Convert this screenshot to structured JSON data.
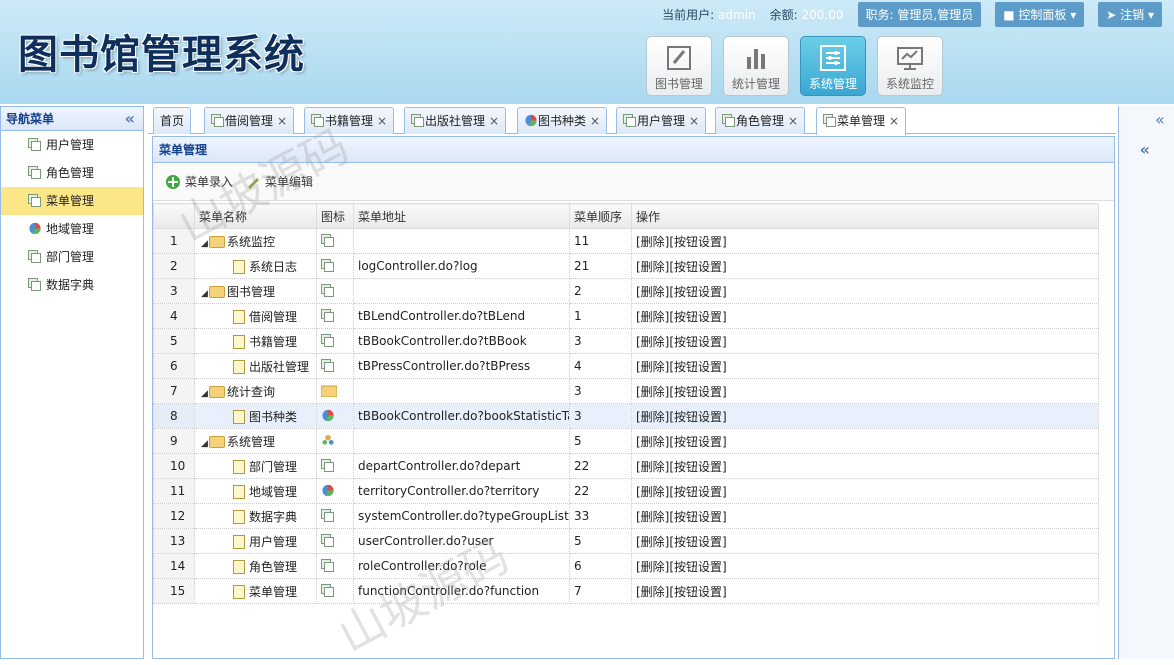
{
  "app": {
    "title": "图书馆管理系统"
  },
  "topbar": {
    "user_label": "当前用户:",
    "user": "admin",
    "balance_label": "余额:",
    "balance": "200.00",
    "role_label": "职务:",
    "role": "管理员,管理员",
    "control_panel": "控制面板",
    "logout": "注销"
  },
  "modules": [
    {
      "label": "图书管理",
      "icon": "edit-icon"
    },
    {
      "label": "统计管理",
      "icon": "bar-chart-icon"
    },
    {
      "label": "系统管理",
      "icon": "settings-sliders-icon"
    },
    {
      "label": "系统监控",
      "icon": "monitor-icon"
    }
  ],
  "nav": {
    "title": "导航菜单",
    "items": [
      {
        "label": "用户管理",
        "icon": "page-icon"
      },
      {
        "label": "角色管理",
        "icon": "page-icon"
      },
      {
        "label": "菜单管理",
        "icon": "page-icon",
        "selected": true
      },
      {
        "label": "地域管理",
        "icon": "pie-icon"
      },
      {
        "label": "部门管理",
        "icon": "page-icon"
      },
      {
        "label": "数据字典",
        "icon": "page-icon"
      }
    ]
  },
  "tabs": [
    {
      "label": "首页",
      "icon": null
    },
    {
      "label": "借阅管理",
      "icon": "page-icon"
    },
    {
      "label": "书籍管理",
      "icon": "page-icon"
    },
    {
      "label": "出版社管理",
      "icon": "page-icon"
    },
    {
      "label": "图书种类",
      "icon": "pie-icon"
    },
    {
      "label": "用户管理",
      "icon": "page-icon"
    },
    {
      "label": "角色管理",
      "icon": "page-icon"
    },
    {
      "label": "菜单管理",
      "icon": "page-icon",
      "active": true
    }
  ],
  "panel": {
    "title": "菜单管理",
    "add_label": "菜单录入",
    "edit_label": "菜单编辑"
  },
  "grid": {
    "headers": [
      "菜单名称",
      "图标",
      "菜单地址",
      "菜单顺序",
      "操作"
    ],
    "rows": [
      {
        "n": "1",
        "name": "系统监控",
        "folder": true,
        "icon": "page-icon",
        "url": "",
        "order": "11",
        "op": "[删除][按钮设置]"
      },
      {
        "n": "2",
        "name": "系统日志",
        "folder": false,
        "icon": "page-icon",
        "url": "logController.do?log",
        "order": "21",
        "op": "[删除][按钮设置]"
      },
      {
        "n": "3",
        "name": "图书管理",
        "folder": true,
        "icon": "page-icon",
        "url": "",
        "order": "2",
        "op": "[删除][按钮设置]"
      },
      {
        "n": "4",
        "name": "借阅管理",
        "folder": false,
        "icon": "page-icon",
        "url": "tBLendController.do?tBLend",
        "order": "1",
        "op": "[删除][按钮设置]"
      },
      {
        "n": "5",
        "name": "书籍管理",
        "folder": false,
        "icon": "page-icon",
        "url": "tBBookController.do?tBBook",
        "order": "3",
        "op": "[删除][按钮设置]"
      },
      {
        "n": "6",
        "name": "出版社管理",
        "folder": false,
        "icon": "page-icon",
        "url": "tBPressController.do?tBPress",
        "order": "4",
        "op": "[删除][按钮设置]"
      },
      {
        "n": "7",
        "name": "统计查询",
        "folder": true,
        "icon": "folder-icon",
        "url": "",
        "order": "3",
        "op": "[删除][按钮设置]"
      },
      {
        "n": "8",
        "name": "图书种类",
        "folder": false,
        "icon": "pie-icon",
        "url": "tBBookController.do?bookStatisticTabs",
        "order": "3",
        "op": "[删除][按钮设置]",
        "hl": true
      },
      {
        "n": "9",
        "name": "系统管理",
        "folder": true,
        "icon": "users-icon",
        "url": "",
        "order": "5",
        "op": "[删除][按钮设置]"
      },
      {
        "n": "10",
        "name": "部门管理",
        "folder": false,
        "icon": "page-icon",
        "url": "departController.do?depart",
        "order": "22",
        "op": "[删除][按钮设置]"
      },
      {
        "n": "11",
        "name": "地域管理",
        "folder": false,
        "icon": "pie-icon",
        "url": "territoryController.do?territory",
        "order": "22",
        "op": "[删除][按钮设置]"
      },
      {
        "n": "12",
        "name": "数据字典",
        "folder": false,
        "icon": "page-icon",
        "url": "systemController.do?typeGroupList",
        "order": "33",
        "op": "[删除][按钮设置]"
      },
      {
        "n": "13",
        "name": "用户管理",
        "folder": false,
        "icon": "page-icon",
        "url": "userController.do?user",
        "order": "5",
        "op": "[删除][按钮设置]"
      },
      {
        "n": "14",
        "name": "角色管理",
        "folder": false,
        "icon": "page-icon",
        "url": "roleController.do?role",
        "order": "6",
        "op": "[删除][按钮设置]"
      },
      {
        "n": "15",
        "name": "菜单管理",
        "folder": false,
        "icon": "page-icon",
        "url": "functionController.do?function",
        "order": "7",
        "op": "[删除][按钮设置]"
      }
    ]
  },
  "watermark": "山坡源码",
  "colors": {
    "header_bg": "#a9d8ef",
    "accent": "#3aa6d2",
    "border": "#99bbe8",
    "selected": "#fbe788"
  }
}
